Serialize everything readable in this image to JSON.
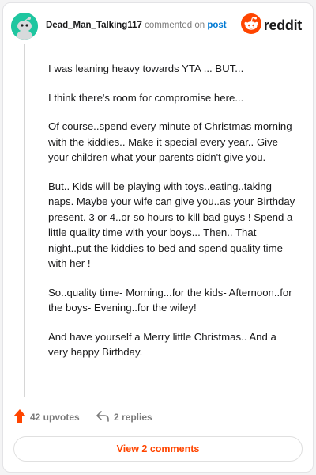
{
  "header": {
    "username": "Dead_Man_Talking117",
    "commented_on": "commented on",
    "post_link": "post",
    "logo_text": "reddit",
    "avatar_icon": "snoo-avatar-icon",
    "logo_icon": "reddit-snoo-icon"
  },
  "comment": {
    "paragraphs": [
      "I was leaning heavy towards YTA ... BUT...",
      "I think there's room for compromise here...",
      "Of course..spend every minute of Christmas morning with the kiddies.. Make it special every year.. Give your children what your parents didn't give you.",
      "But.. Kids will be playing with toys..eating..taking naps. Maybe your wife can give you..as your Birthday present. 3 or 4..or so hours to kill bad guys ! Spend a little quality time with your boys... Then.. That night..put the kiddies to bed and spend quality time with her !",
      "So..quality time- Morning...for the kids- Afternoon..for the boys- Evening..for the wifey!",
      "And have yourself a Merry little Christmas.. And a very happy Birthday."
    ]
  },
  "actions": {
    "upvotes": "42 upvotes",
    "replies": "2 replies",
    "upvote_icon": "upvote-arrow-icon",
    "reply_icon": "reply-arrow-icon"
  },
  "view_comments": "View 2 comments",
  "colors": {
    "brand": "#ff4500",
    "link": "#0079d3",
    "avatar_bg": "#1fc6a0"
  }
}
